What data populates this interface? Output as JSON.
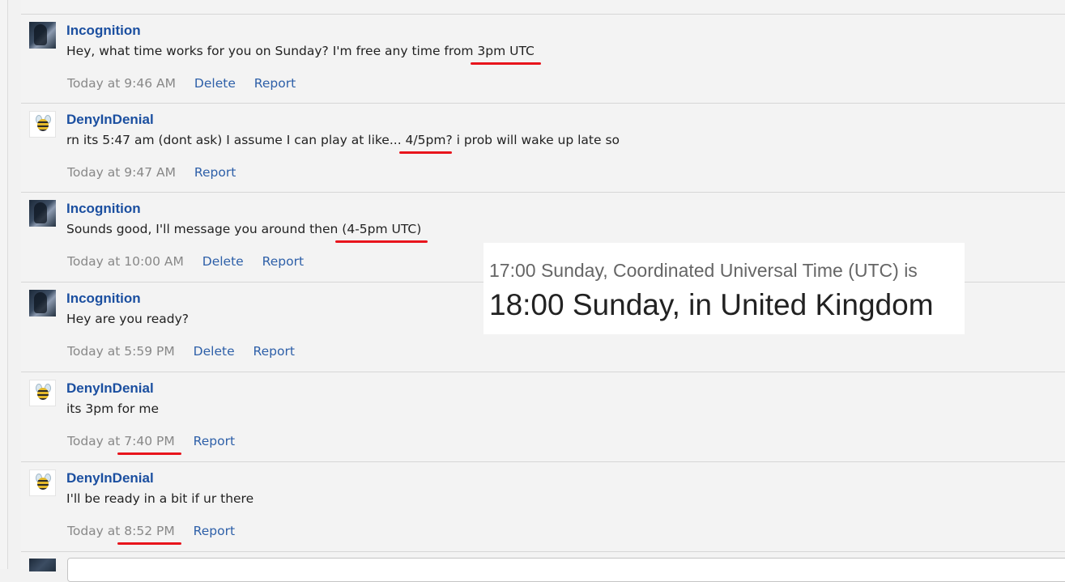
{
  "messages": [
    {
      "user": "Incognition",
      "avatar": "dark-portrait-avatar",
      "text_before": "Hey, what time works for you on Sunday? I'm free any time from ",
      "text_highlight": "3pm UTC",
      "text_after": "",
      "timestamp_prefix": "Today at ",
      "timestamp_value": "9:46 AM",
      "actions": [
        "Delete",
        "Report"
      ]
    },
    {
      "user": "DenyInDenial",
      "avatar": "bee-avatar",
      "text_before": "rn its 5:47 am (dont ask) I assume I can play at like... ",
      "text_highlight": "4/5pm",
      "text_after": "? i prob will wake up late so",
      "timestamp_prefix": "Today at ",
      "timestamp_value": "9:47 AM",
      "actions": [
        "Report"
      ]
    },
    {
      "user": "Incognition",
      "avatar": "dark-portrait-avatar",
      "text_before": "Sounds good, I'll message you around then ",
      "text_highlight": "(4-5pm UTC)",
      "text_after": "",
      "timestamp_prefix": "Today at ",
      "timestamp_value": "10:00 AM",
      "actions": [
        "Delete",
        "Report"
      ]
    },
    {
      "user": "Incognition",
      "avatar": "dark-portrait-avatar",
      "text_before": "Hey are you ready?",
      "text_highlight": "",
      "text_after": "",
      "timestamp_prefix": "Today at ",
      "timestamp_value": "5:59 PM",
      "actions": [
        "Delete",
        "Report"
      ]
    },
    {
      "user": "DenyInDenial",
      "avatar": "bee-avatar",
      "text_before": "its 3pm for me",
      "text_highlight": "",
      "text_after": "",
      "timestamp_prefix": "Today at ",
      "timestamp_value": "7:40 PM",
      "actions": [
        "Report"
      ]
    },
    {
      "user": "DenyInDenial",
      "avatar": "bee-avatar",
      "text_before": "I'll be ready in a bit if ur there",
      "text_highlight": "",
      "text_after": "",
      "timestamp_prefix": "Today at ",
      "timestamp_value": "8:52 PM",
      "actions": [
        "Report"
      ]
    }
  ],
  "time_conversion": {
    "line1": "17:00 Sunday, Coordinated Universal Time (UTC) is",
    "line2": "18:00 Sunday, in United Kingdom"
  },
  "colors": {
    "username": "#1b4fa0",
    "link": "#2d5fa8",
    "timestamp": "#888888",
    "highlight_underline": "#e8141c"
  }
}
